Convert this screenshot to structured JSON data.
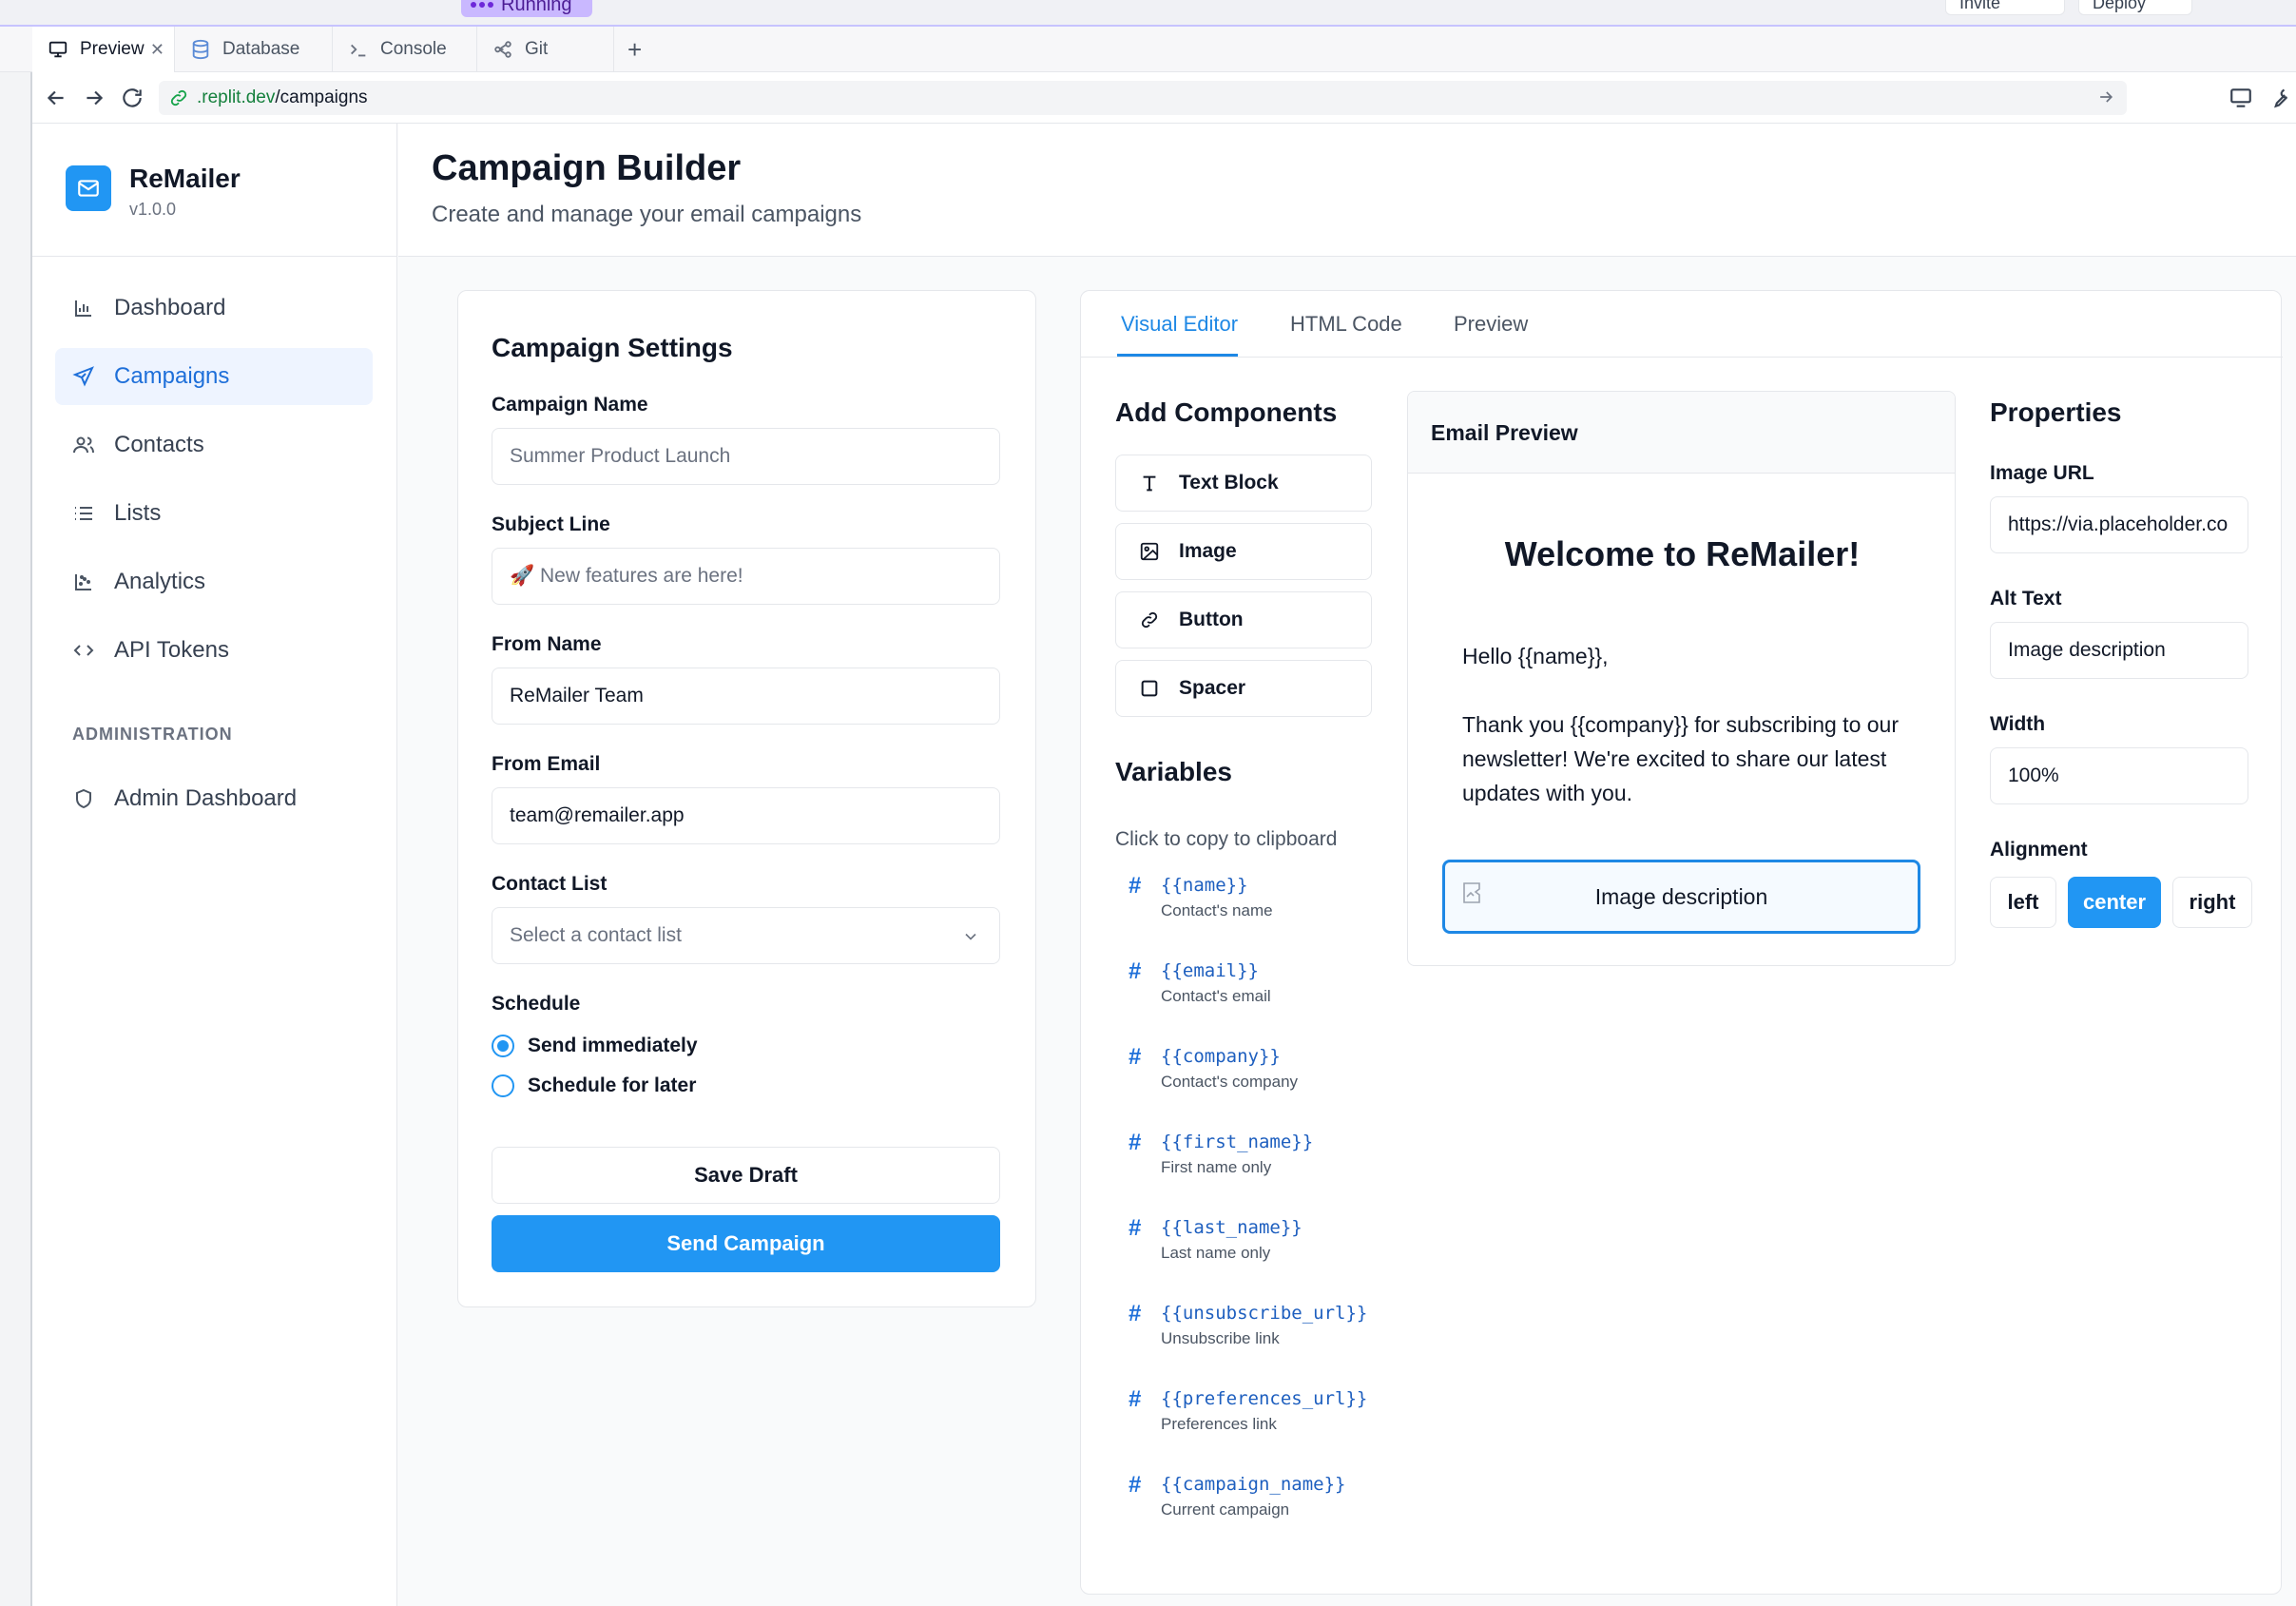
{
  "ide": {
    "status_pill": "Running",
    "top_buttons": [
      "Invite",
      "Deploy"
    ],
    "tabs": [
      {
        "label": "Preview",
        "icon": "monitor-icon"
      },
      {
        "label": "Database",
        "icon": "database-icon"
      },
      {
        "label": "Console",
        "icon": "terminal-icon"
      },
      {
        "label": "Git",
        "icon": "git-icon"
      }
    ],
    "add_tab": "+",
    "url": {
      "host": ".replit.dev",
      "path": "/campaigns"
    }
  },
  "brand": {
    "name": "ReMailer",
    "version": "v1.0.0"
  },
  "sidebar": {
    "items": [
      {
        "label": "Dashboard",
        "icon": "bar-chart-icon"
      },
      {
        "label": "Campaigns",
        "icon": "send-icon",
        "active": true
      },
      {
        "label": "Contacts",
        "icon": "users-icon"
      },
      {
        "label": "Lists",
        "icon": "list-icon"
      },
      {
        "label": "Analytics",
        "icon": "scatter-chart-icon"
      },
      {
        "label": "API Tokens",
        "icon": "code-icon"
      }
    ],
    "section": "ADMINISTRATION",
    "admin_items": [
      {
        "label": "Admin Dashboard",
        "icon": "shield-icon"
      }
    ]
  },
  "header": {
    "title": "Campaign Builder",
    "subtitle": "Create and manage your email campaigns"
  },
  "settings": {
    "title": "Campaign Settings",
    "campaign_name": {
      "label": "Campaign Name",
      "placeholder": "Summer Product Launch"
    },
    "subject": {
      "label": "Subject Line",
      "placeholder": "🚀 New features are here!"
    },
    "from_name": {
      "label": "From Name",
      "value": "ReMailer Team"
    },
    "from_email": {
      "label": "From Email",
      "value": "team@remailer.app"
    },
    "contact_list": {
      "label": "Contact List",
      "placeholder": "Select a contact list"
    },
    "schedule": {
      "label": "Schedule",
      "options": [
        "Send immediately",
        "Schedule for later"
      ],
      "selected": "Send immediately"
    },
    "save_draft": "Save Draft",
    "send": "Send Campaign"
  },
  "editor": {
    "tabs": [
      "Visual Editor",
      "HTML Code",
      "Preview"
    ],
    "active_tab": "Visual Editor",
    "components_title": "Add Components",
    "components": [
      {
        "label": "Text Block",
        "icon": "text-icon"
      },
      {
        "label": "Image",
        "icon": "image-icon"
      },
      {
        "label": "Button",
        "icon": "link-icon"
      },
      {
        "label": "Spacer",
        "icon": "square-icon"
      }
    ],
    "variables_title": "Variables",
    "variables_hint": "Click to copy to clipboard",
    "variables": [
      {
        "code": "{{name}}",
        "desc": "Contact's name"
      },
      {
        "code": "{{email}}",
        "desc": "Contact's email"
      },
      {
        "code": "{{company}}",
        "desc": "Contact's company"
      },
      {
        "code": "{{first_name}}",
        "desc": "First name only"
      },
      {
        "code": "{{last_name}}",
        "desc": "Last name only"
      },
      {
        "code": "{{unsubscribe_url}}",
        "desc": "Unsubscribe link"
      },
      {
        "code": "{{preferences_url}}",
        "desc": "Preferences link"
      },
      {
        "code": "{{campaign_name}}",
        "desc": "Current campaign"
      }
    ],
    "preview": {
      "title": "Email Preview",
      "heading": "Welcome to ReMailer!",
      "greeting": "Hello {{name}},",
      "body": "Thank you {{company}} for subscribing to our newsletter! We're excited to share our latest updates with you.",
      "image_alt": "Image description"
    },
    "properties": {
      "title": "Properties",
      "image_url_label": "Image URL",
      "image_url": "https://via.placeholder.co",
      "alt_label": "Alt Text",
      "alt": "Image description",
      "width_label": "Width",
      "width": "100%",
      "align_label": "Alignment",
      "align_options": [
        "left",
        "center",
        "right"
      ],
      "align_selected": "center"
    }
  }
}
